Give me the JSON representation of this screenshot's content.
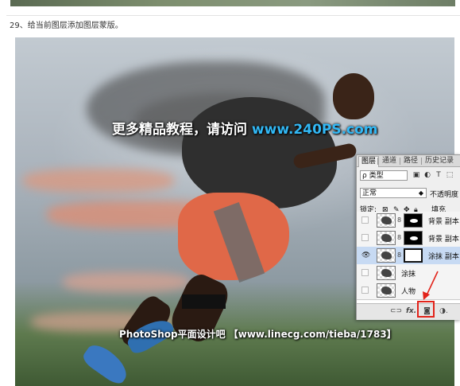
{
  "step_text": "29、给当前图层添加图层蒙版。",
  "watermark": {
    "prefix": "更多精品教程，请访问 ",
    "url": "www.240PS.com"
  },
  "footer_watermark": "PhotoShop平面设计吧 【www.linecg.com/tieba/1783】",
  "panel": {
    "tabs": [
      "图层",
      "通道",
      "路径",
      "历史记录"
    ],
    "filter_type": "ρ 类型",
    "blend_mode": "正常",
    "opacity_label": "不透明度",
    "lock_label": "锁定:",
    "fill_label": "填充",
    "layers": [
      {
        "name": "背景 副本",
        "visible": false,
        "mask": "black-figure"
      },
      {
        "name": "背景 副本",
        "visible": false,
        "mask": "black-figure"
      },
      {
        "name": "涂抹 副本",
        "visible": true,
        "mask": "white",
        "selected": true
      },
      {
        "name": "涂抹",
        "visible": false,
        "mask": "none"
      },
      {
        "name": "人物",
        "visible": false,
        "mask": "none"
      }
    ],
    "bottom_icons": [
      "link-icon",
      "fx-icon",
      "add-mask-icon",
      "adjustment-icon"
    ],
    "fx_label": "fx."
  },
  "colors": {
    "highlight": "#e2231a",
    "url": "#32b8f5",
    "selected_row": "#c7daf3"
  }
}
